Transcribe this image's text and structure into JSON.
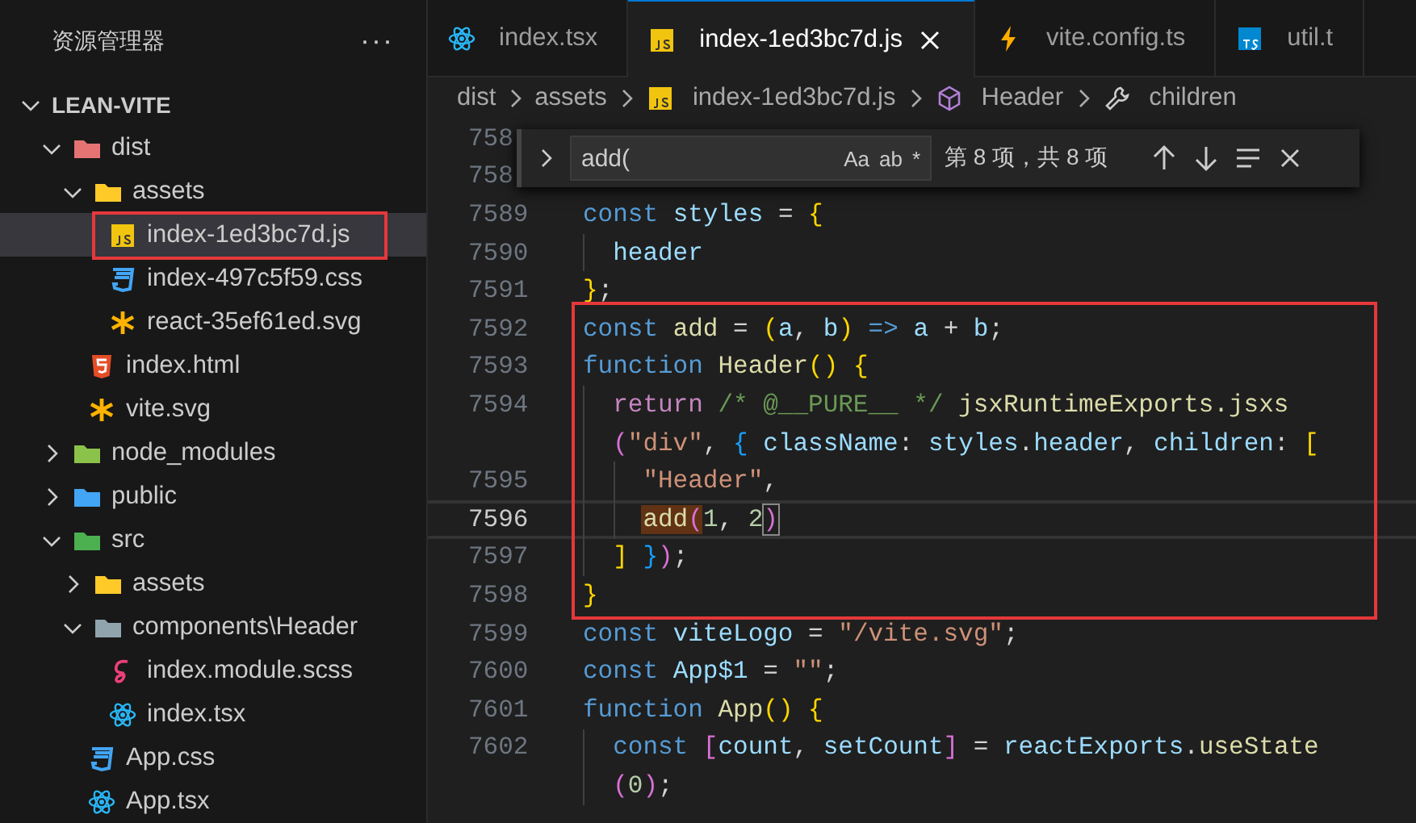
{
  "sidebar": {
    "title": "资源管理器",
    "more": "···",
    "tree": [
      {
        "label": "LEAN-VITE",
        "kind": "root",
        "expanded": true,
        "selected": false,
        "annotated": false,
        "children": [
          {
            "label": "dist",
            "kind": "folder-dist",
            "expanded": true,
            "selected": false,
            "annotated": false,
            "children": [
              {
                "label": "assets",
                "kind": "folder-assets",
                "expanded": true,
                "selected": false,
                "annotated": false,
                "children": [
                  {
                    "label": "index-1ed3bc7d.js",
                    "kind": "js",
                    "selected": true,
                    "annotated": true
                  },
                  {
                    "label": "index-497c5f59.css",
                    "kind": "css",
                    "selected": false,
                    "annotated": false
                  },
                  {
                    "label": "react-35ef61ed.svg",
                    "kind": "svg",
                    "selected": false,
                    "annotated": false
                  }
                ]
              },
              {
                "label": "index.html",
                "kind": "html",
                "selected": false,
                "annotated": false
              },
              {
                "label": "vite.svg",
                "kind": "svg",
                "selected": false,
                "annotated": false
              }
            ]
          },
          {
            "label": "node_modules",
            "kind": "folder-node",
            "expanded": false,
            "selected": false,
            "annotated": false
          },
          {
            "label": "public",
            "kind": "folder-public",
            "expanded": false,
            "selected": false,
            "annotated": false
          },
          {
            "label": "src",
            "kind": "folder-src",
            "expanded": true,
            "selected": false,
            "annotated": false,
            "children": [
              {
                "label": "assets",
                "kind": "folder-assets",
                "expanded": false,
                "selected": false,
                "annotated": false
              },
              {
                "label": "components\\Header",
                "kind": "folder-plain",
                "expanded": true,
                "selected": false,
                "annotated": false,
                "children": [
                  {
                    "label": "index.module.scss",
                    "kind": "scss",
                    "selected": false,
                    "annotated": false
                  },
                  {
                    "label": "index.tsx",
                    "kind": "react",
                    "selected": false,
                    "annotated": false
                  }
                ]
              },
              {
                "label": "App.css",
                "kind": "css",
                "selected": false,
                "annotated": false
              },
              {
                "label": "App.tsx",
                "kind": "react",
                "selected": false,
                "annotated": false
              }
            ]
          }
        ]
      }
    ]
  },
  "tabs": [
    {
      "label": "index.tsx",
      "kind": "react",
      "selected": false
    },
    {
      "label": "index-1ed3bc7d.js",
      "kind": "js",
      "selected": true
    },
    {
      "label": "vite.config.ts",
      "kind": "bolt",
      "selected": false
    },
    {
      "label": "util.t",
      "kind": "ts",
      "selected": false
    }
  ],
  "breadcrumbs": [
    {
      "label": "dist",
      "kind": "plain"
    },
    {
      "label": "assets",
      "kind": "plain"
    },
    {
      "label": "index-1ed3bc7d.js",
      "kind": "js"
    },
    {
      "label": "Header",
      "kind": "cube"
    },
    {
      "label": "children",
      "kind": "wrench"
    }
  ],
  "find_widget": {
    "value": "add(",
    "options": [
      "Aa",
      "ab",
      "*"
    ],
    "result": "第 8 项，共 8 项"
  },
  "code": {
    "blocks": [
      {
        "annotated": false,
        "lines": [
          {
            "number": "758",
            "current": false
          },
          {
            "number": "758",
            "current": false
          },
          {
            "number": "7589",
            "current": false,
            "tokens": [
              {
                "kind": "kw",
                "t": "const"
              },
              {
                "kind": "var",
                "t": " styles"
              },
              {
                "kind": "punc",
                "t": " = "
              },
              {
                "kind": "brace",
                "t": "{"
              }
            ]
          },
          {
            "number": "7590",
            "current": false,
            "tokens": [
              {
                "kind": "var",
                "t": "  header"
              }
            ]
          },
          {
            "number": "7591",
            "current": false,
            "tokens": [
              {
                "kind": "brace",
                "t": "}"
              },
              {
                "kind": "punc",
                "t": ";"
              }
            ]
          }
        ]
      },
      {
        "annotated": true,
        "lines": [
          {
            "number": "7592",
            "current": false,
            "tokens": [
              {
                "kind": "kw",
                "t": "const"
              },
              {
                "kind": "fn",
                "t": " add"
              },
              {
                "kind": "punc",
                "t": " = "
              },
              {
                "kind": "brace",
                "t": "("
              },
              {
                "kind": "var",
                "t": "a"
              },
              {
                "kind": "punc",
                "t": ", "
              },
              {
                "kind": "var",
                "t": "b"
              },
              {
                "kind": "brace",
                "t": ")"
              },
              {
                "kind": "kw",
                "t": " =>"
              },
              {
                "kind": "var",
                "t": " a"
              },
              {
                "kind": "punc",
                "t": " + "
              },
              {
                "kind": "var",
                "t": "b"
              },
              {
                "kind": "punc",
                "t": ";"
              }
            ]
          },
          {
            "number": "7593",
            "current": false,
            "tokens": [
              {
                "kind": "kw",
                "t": "function"
              },
              {
                "kind": "fn",
                "t": " Header"
              },
              {
                "kind": "brace",
                "t": "() {"
              }
            ]
          },
          {
            "number": "7594",
            "current": false,
            "tokens": [
              {
                "kind": "ctrl",
                "t": "  return"
              },
              {
                "kind": "comment",
                "t": " /* @__PURE__ */"
              },
              {
                "kind": "fn",
                "t": " jsxRuntimeExports.jsxs"
              }
            ]
          },
          {
            "current": false,
            "tokens": [
              {
                "kind": "brace2",
                "t": "  ("
              },
              {
                "kind": "str",
                "t": "\"div\""
              },
              {
                "kind": "punc",
                "t": ", "
              },
              {
                "kind": "brace3",
                "t": "{"
              },
              {
                "kind": "var",
                "t": " className"
              },
              {
                "kind": "punc",
                "t": ": "
              },
              {
                "kind": "var",
                "t": "styles"
              },
              {
                "kind": "punc",
                "t": "."
              },
              {
                "kind": "var",
                "t": "header"
              },
              {
                "kind": "punc",
                "t": ", "
              },
              {
                "kind": "var",
                "t": "children"
              },
              {
                "kind": "punc",
                "t": ": "
              },
              {
                "kind": "brace",
                "t": "["
              }
            ]
          },
          {
            "number": "7595",
            "current": false,
            "tokens": [
              {
                "kind": "str",
                "t": "    \"Header\""
              },
              {
                "kind": "punc",
                "t": ","
              }
            ]
          },
          {
            "number": "7596",
            "current": true,
            "tokens": [
              {
                "kind": "match",
                "t": "    add"
              },
              {
                "kind": "matchbrace",
                "t": "("
              },
              {
                "kind": "num",
                "t": "1"
              },
              {
                "kind": "punc",
                "t": ", "
              },
              {
                "kind": "num",
                "t": "2"
              },
              {
                "kind": "pairbrace",
                "t": ")"
              }
            ]
          },
          {
            "number": "7597",
            "current": false,
            "tokens": [
              {
                "kind": "brace",
                "t": "  ]"
              },
              {
                "kind": "brace3",
                "t": " }"
              },
              {
                "kind": "brace2",
                "t": ")"
              },
              {
                "kind": "punc",
                "t": ";"
              }
            ]
          },
          {
            "number": "7598",
            "current": false,
            "tokens": [
              {
                "kind": "brace",
                "t": "}"
              }
            ]
          }
        ]
      },
      {
        "annotated": false,
        "lines": [
          {
            "number": "7599",
            "current": false,
            "tokens": [
              {
                "kind": "kw",
                "t": "const"
              },
              {
                "kind": "var",
                "t": " viteLogo"
              },
              {
                "kind": "punc",
                "t": " = "
              },
              {
                "kind": "str",
                "t": "\"/vite.svg\""
              },
              {
                "kind": "punc",
                "t": ";"
              }
            ]
          },
          {
            "number": "7600",
            "current": false,
            "tokens": [
              {
                "kind": "kw",
                "t": "const"
              },
              {
                "kind": "var",
                "t": " App$1"
              },
              {
                "kind": "punc",
                "t": " = "
              },
              {
                "kind": "str",
                "t": "\"\""
              },
              {
                "kind": "punc",
                "t": ";"
              }
            ]
          },
          {
            "number": "7601",
            "current": false,
            "tokens": [
              {
                "kind": "kw",
                "t": "function"
              },
              {
                "kind": "fn",
                "t": " App"
              },
              {
                "kind": "brace",
                "t": "() {"
              }
            ]
          },
          {
            "number": "7602",
            "current": false,
            "tokens": [
              {
                "kind": "kw",
                "t": "  const"
              },
              {
                "kind": "brace2",
                "t": " ["
              },
              {
                "kind": "var",
                "t": "count"
              },
              {
                "kind": "punc",
                "t": ", "
              },
              {
                "kind": "var",
                "t": "setCount"
              },
              {
                "kind": "brace2",
                "t": "]"
              },
              {
                "kind": "punc",
                "t": " = "
              },
              {
                "kind": "var",
                "t": "reactExports"
              },
              {
                "kind": "punc",
                "t": "."
              },
              {
                "kind": "fn",
                "t": "useState"
              }
            ]
          },
          {
            "current": false,
            "tokens": [
              {
                "kind": "brace2",
                "t": "  ("
              },
              {
                "kind": "num",
                "t": "0"
              },
              {
                "kind": "brace2",
                "t": ")"
              },
              {
                "kind": "punc",
                "t": ";"
              }
            ]
          }
        ]
      }
    ]
  }
}
